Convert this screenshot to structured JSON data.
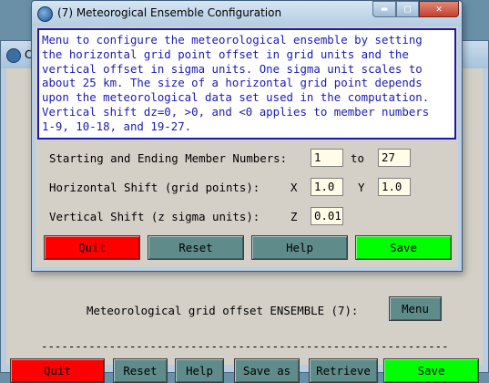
{
  "parent_window": {
    "title": "C",
    "ensemble_label": "Meteorological grid offset ENSEMBLE (7):",
    "menu_button": "Menu",
    "separator": "--------------------------------------------------------------",
    "buttons": {
      "quit": "Quit",
      "reset": "Reset",
      "help": "Help",
      "save_as": "Save as",
      "retrieve": "Retrieve",
      "save": "Save"
    }
  },
  "dialog": {
    "title": "(7) Meteorogical Ensemble Configuration",
    "window_controls": {
      "close": "✕"
    },
    "help_text": "Menu to configure the meteorological ensemble by setting\nthe horizontal grid point offset in grid units and the\nvertical offset in sigma units. One sigma unit scales to\nabout 25 km. The size of a horizontal grid point depends\nupon the meteorological data set used in the computation.\nVertical shift dz=0, >0, and <0 applies to member numbers\n1-9, 10-18, and 19-27.",
    "member_numbers": {
      "label": "Starting and Ending Member Numbers:",
      "start": "1",
      "to_label": "to",
      "end": "27"
    },
    "horizontal_shift": {
      "label": "Horizontal Shift (grid points):",
      "x_label": "X",
      "x": "1.0",
      "y_label": "Y",
      "y": "1.0"
    },
    "vertical_shift": {
      "label": "Vertical Shift (z sigma units):",
      "z_label": "Z",
      "z": "0.01"
    },
    "buttons": {
      "quit": "Quit",
      "reset": "Reset",
      "help": "Help",
      "save": "Save"
    }
  },
  "colors": {
    "quit": "#ff0000",
    "neutral": "#5f8b8b",
    "save": "#00ff00",
    "help_text": "#1a1ab4"
  }
}
